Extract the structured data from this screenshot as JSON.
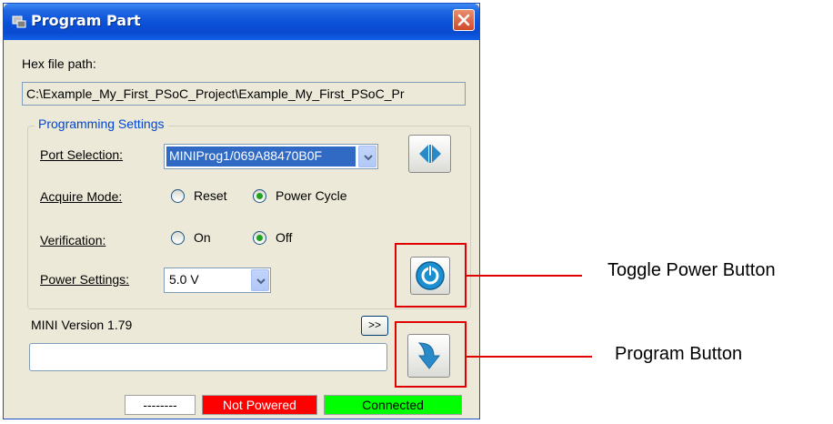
{
  "window": {
    "title": "Program Part",
    "icon": "program-part-app-icon",
    "close_icon": "close-icon"
  },
  "hex_file": {
    "label": "Hex file path:",
    "value": "C:\\Example_My_First_PSoC_Project\\Example_My_First_PSoC_Pr"
  },
  "programming_settings": {
    "title": "Programming Settings",
    "port_selection": {
      "label": "Port Selection:",
      "value": "MINIProg1/069A88470B0F"
    },
    "acquire_mode": {
      "label": "Acquire Mode:",
      "options": [
        "Reset",
        "Power Cycle"
      ],
      "selected": "Power Cycle"
    },
    "verification": {
      "label": "Verification:",
      "options": [
        "On",
        "Off"
      ],
      "selected": "Off"
    },
    "power_settings": {
      "label": "Power Settings:",
      "value": "5.0 V"
    }
  },
  "buttons": {
    "port_connect_icon": "port-connect-icon",
    "toggle_power_icon": "power-icon",
    "program_icon": "program-download-icon",
    "expand_label": ">>"
  },
  "version_text": "MINI Version 1.79",
  "progress_value": 0,
  "status_bar": {
    "field1": "--------",
    "power_status": "Not Powered",
    "connection_status": "Connected"
  },
  "callouts": {
    "toggle_power": "Toggle Power Button",
    "program": "Program Button"
  },
  "colors": {
    "highlight_red": "#e00000",
    "not_powered_bg": "#ff0000",
    "connected_bg": "#00ff00",
    "title_blue": "#0a50d8",
    "group_title": "#0046d5"
  }
}
